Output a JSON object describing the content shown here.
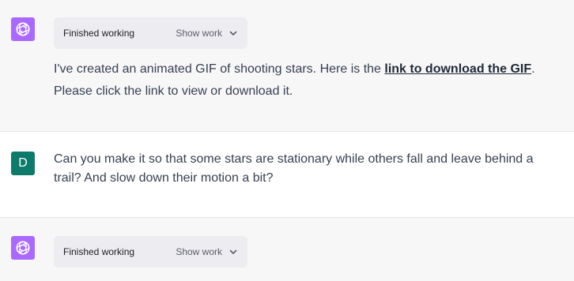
{
  "messages": [
    {
      "role": "assistant",
      "avatar_icon": "openai-logo-icon",
      "work_status": "Finished working",
      "show_work_label": "Show work",
      "text_before_link": "I've created an animated GIF of shooting stars. Here is the ",
      "link_text": "link to download the GIF",
      "text_after_link": ". Please click the link to view or download it."
    },
    {
      "role": "user",
      "avatar_letter": "D",
      "text": "Can you make it so that some stars are stationary while others fall and leave behind a trail? And slow down their motion a bit?"
    },
    {
      "role": "assistant",
      "avatar_icon": "openai-logo-icon",
      "work_status": "Finished working",
      "show_work_label": "Show work"
    }
  ],
  "colors": {
    "assistant_bg": "#f7f7f8",
    "gpt_avatar": "#ab68ff",
    "user_avatar": "#0e7b6a",
    "pill_bg": "#ececf1"
  }
}
